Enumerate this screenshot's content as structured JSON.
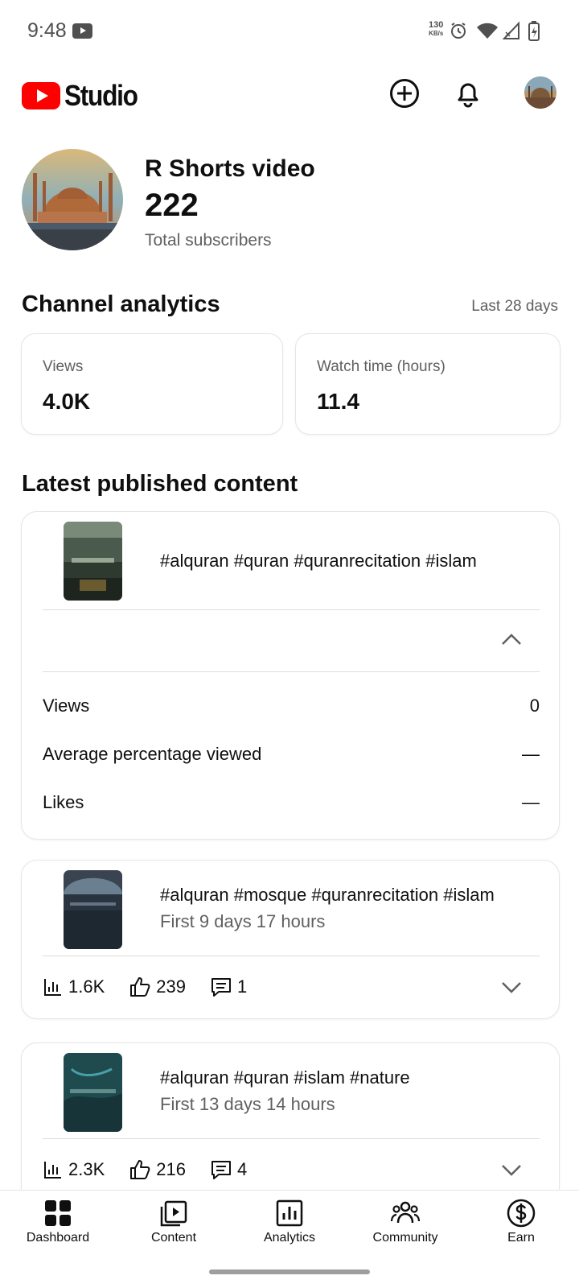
{
  "status_bar": {
    "time": "9:48",
    "speed_value": "130",
    "speed_unit": "KB/s",
    "icons": [
      "youtube-icon",
      "alarm-icon",
      "wifi-icon",
      "signal-icon",
      "battery-charging-icon"
    ]
  },
  "header": {
    "logo_text": "Studio",
    "actions": [
      "create-icon",
      "notifications-icon",
      "account-avatar"
    ]
  },
  "channel": {
    "name": "R Shorts video",
    "subscribers": "222",
    "subscribers_label": "Total subscribers"
  },
  "analytics": {
    "title": "Channel analytics",
    "range": "Last 28 days",
    "cards": [
      {
        "label": "Views",
        "value": "4.0K"
      },
      {
        "label": "Watch time (hours)",
        "value": "11.4"
      }
    ]
  },
  "latest": {
    "title": "Latest published content",
    "items": [
      {
        "title": "#alquran #quran #quranrecitation #islam",
        "expanded": true,
        "metrics": [
          {
            "label": "Views",
            "value": "0"
          },
          {
            "label": "Average percentage viewed",
            "value": "—"
          },
          {
            "label": "Likes",
            "value": "—"
          }
        ]
      },
      {
        "title": "#alquran #mosque #quranrecitation #islam",
        "subtitle": "First 9 days 17 hours",
        "views": "1.6K",
        "likes": "239",
        "comments": "1"
      },
      {
        "title": "#alquran #quran #islam #nature",
        "subtitle": "First 13 days 14 hours",
        "views": "2.3K",
        "likes": "216",
        "comments": "4"
      }
    ]
  },
  "bottom_nav": {
    "items": [
      {
        "label": "Dashboard",
        "icon": "dashboard-icon"
      },
      {
        "label": "Content",
        "icon": "content-icon"
      },
      {
        "label": "Analytics",
        "icon": "analytics-icon"
      },
      {
        "label": "Community",
        "icon": "community-icon"
      },
      {
        "label": "Earn",
        "icon": "earn-icon"
      }
    ],
    "active": "Dashboard"
  },
  "colors": {
    "brand_red": "#ff0000",
    "text_primary": "#0f0f0f",
    "text_secondary": "#606060",
    "border": "#e5e5e5"
  }
}
